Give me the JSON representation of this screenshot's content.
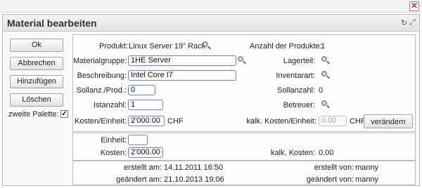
{
  "window": {
    "close_glyph": "✕"
  },
  "dialog": {
    "title": "Material bearbeiten",
    "icons": [
      "refresh-icon",
      "expand-icon"
    ],
    "refresh_glyph": "↻",
    "expand_glyph": "⤢"
  },
  "sidebar": {
    "ok_label": "Ok",
    "cancel_label": "Abbrechen",
    "add_label": "Hinzufügen",
    "delete_label": "Löschen",
    "palette_label": "zweite Palette:",
    "palette_checked": true,
    "check_glyph": "✓"
  },
  "main": {
    "produkt_label": "Produkt:",
    "produkt_value": "Linux Server 19\" Rack",
    "anzahl_label": "Anzahl der Produkte:",
    "anzahl_value": "1",
    "materialgruppe_label": "Materialgruppe:",
    "materialgruppe_value": "1HE Server",
    "lagerteil_label": "Lagerteil:",
    "beschreibung_label": "Beschreibung:",
    "beschreibung_value": "Intel Core I7",
    "inventarart_label": "Inventarart:",
    "sollanz_label": "Sollanz./Prod.:",
    "sollanz_value": "0",
    "sollanzahl_label": "Sollanzahl:",
    "sollanzahl_value": "0",
    "istanzahl_label": "Istanzahl:",
    "istanzahl_value": "1",
    "betreuer_label": "Betreuer:",
    "kosten_einheit_label": "Kosten/Einheit:",
    "kosten_einheit_value": "2'000.00",
    "currency": "CHF",
    "kalk_kosten_einheit_label": "kalk. Kosten/Einheit:",
    "kalk_kosten_einheit_value": "0.00",
    "change_label": "verändern"
  },
  "units": {
    "einheit_label": "Einheit:",
    "einheit_value": "",
    "kosten_label": "Kosten:",
    "kosten_value": "2'000.00",
    "kalk_kosten_label": "kalk. Kosten:",
    "kalk_kosten_value": "0.00"
  },
  "meta": {
    "erstellt_am_label": "erstellt am:",
    "erstellt_am_value": "14.11.2011 16:50",
    "erstellt_von_label": "erstellt von:",
    "erstellt_von_value": "manny",
    "geaendert_am_label": "geändert am:",
    "geaendert_am_value": "21.10.2013 19:06",
    "geaendert_von_label": "geändert von:",
    "geaendert_von_value": "manny"
  }
}
